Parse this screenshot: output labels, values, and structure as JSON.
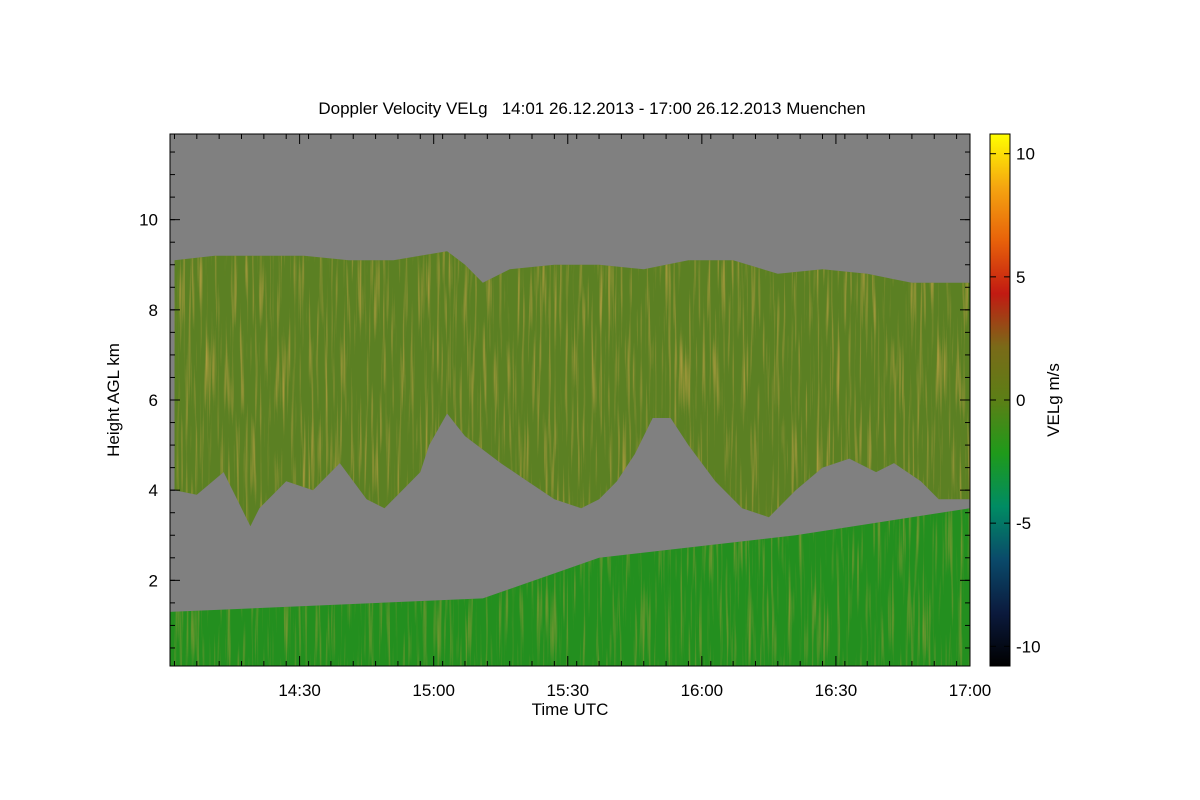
{
  "chart_data": {
    "type": "heatmap",
    "title": "Doppler Velocity VELg   14:01 26.12.2013 - 17:00 26.12.2013 Muenchen",
    "xlabel": "Time UTC",
    "ylabel": "Height AGL km",
    "x_range": [
      "14:01",
      "17:00"
    ],
    "y_range": [
      0.1,
      11.9
    ],
    "x_ticks": [
      "14:30",
      "15:00",
      "15:30",
      "16:00",
      "16:30",
      "17:00"
    ],
    "x_tick_minutes": [
      29,
      59,
      89,
      119,
      149,
      179
    ],
    "x_total_minutes": 179,
    "y_ticks": [
      "2",
      "4",
      "6",
      "8",
      "10"
    ],
    "y_tick_values": [
      2,
      4,
      6,
      8,
      10
    ],
    "colorbar": {
      "label": "VELg m/s",
      "range": [
        -10.8,
        10.8
      ],
      "ticks": [
        "10",
        "5",
        "0",
        "-5",
        "-10"
      ],
      "tick_values": [
        10,
        5,
        0,
        -5,
        -10
      ],
      "colors": [
        "#000000",
        "#0b1a3d",
        "#0a4a6a",
        "#008c63",
        "#1f9a1a",
        "#5c7f16",
        "#7a6a18",
        "#c21a12",
        "#e8620a",
        "#f5a510",
        "#ffff00"
      ]
    },
    "no_signal_color": "#808080",
    "cloud_top_km": [
      [
        1,
        9.1
      ],
      [
        10,
        9.2
      ],
      [
        20,
        9.2
      ],
      [
        30,
        9.2
      ],
      [
        40,
        9.1
      ],
      [
        50,
        9.1
      ],
      [
        62,
        9.3
      ],
      [
        66,
        9.0
      ],
      [
        70,
        8.6
      ],
      [
        76,
        8.9
      ],
      [
        86,
        9.0
      ],
      [
        96,
        9.0
      ],
      [
        106,
        8.9
      ],
      [
        116,
        9.1
      ],
      [
        126,
        9.1
      ],
      [
        136,
        8.8
      ],
      [
        146,
        8.9
      ],
      [
        156,
        8.8
      ],
      [
        166,
        8.6
      ],
      [
        176,
        8.6
      ],
      [
        179,
        8.6
      ]
    ],
    "cloud_base_km": [
      [
        1,
        4.0
      ],
      [
        6,
        3.9
      ],
      [
        12,
        4.4
      ],
      [
        16,
        3.6
      ],
      [
        18,
        3.2
      ],
      [
        20,
        3.6
      ],
      [
        26,
        4.2
      ],
      [
        32,
        4.0
      ],
      [
        38,
        4.6
      ],
      [
        44,
        3.8
      ],
      [
        48,
        3.6
      ],
      [
        52,
        4.0
      ],
      [
        56,
        4.4
      ],
      [
        58,
        5.0
      ],
      [
        62,
        5.7
      ],
      [
        66,
        5.2
      ],
      [
        74,
        4.6
      ],
      [
        80,
        4.2
      ],
      [
        86,
        3.8
      ],
      [
        92,
        3.6
      ],
      [
        96,
        3.8
      ],
      [
        100,
        4.2
      ],
      [
        104,
        4.8
      ],
      [
        108,
        5.6
      ],
      [
        112,
        5.6
      ],
      [
        116,
        5.0
      ],
      [
        122,
        4.2
      ],
      [
        128,
        3.6
      ],
      [
        134,
        3.4
      ],
      [
        140,
        4.0
      ],
      [
        146,
        4.5
      ],
      [
        152,
        4.7
      ],
      [
        158,
        4.4
      ],
      [
        162,
        4.6
      ],
      [
        168,
        4.2
      ],
      [
        172,
        3.8
      ],
      [
        179,
        3.8
      ]
    ]
  }
}
